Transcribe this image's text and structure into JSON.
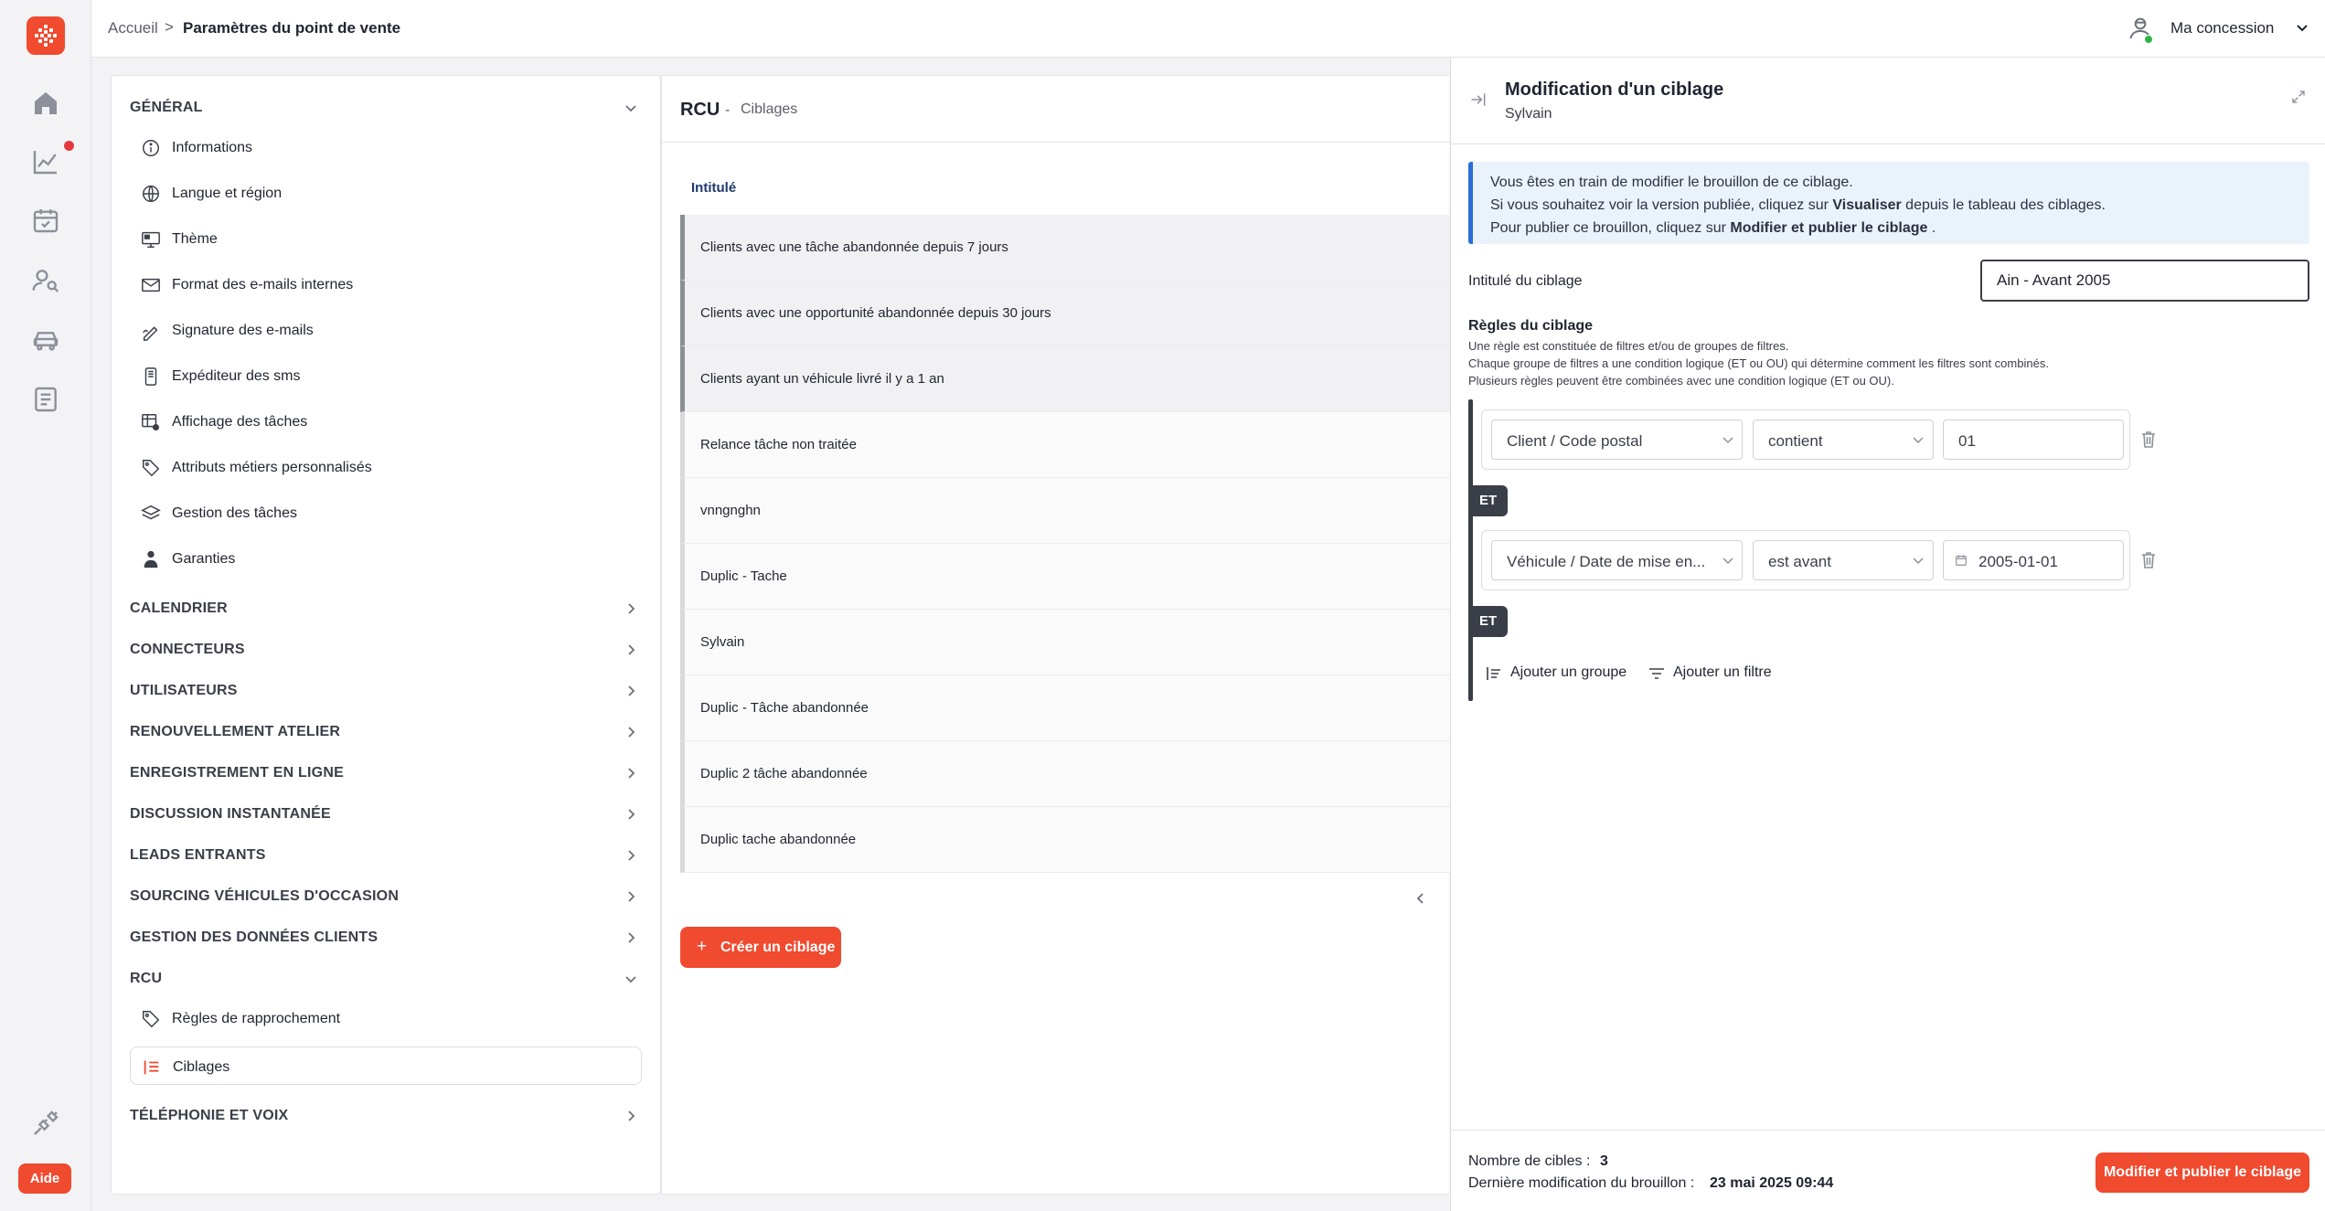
{
  "colors": {
    "brand": "#f04a2f",
    "info_bg": "#eaf2fc",
    "info_border": "#2a6ed8",
    "online": "#2fb344",
    "notification": "#e5393f"
  },
  "rail": {
    "icons": [
      "home-icon",
      "chart-line-icon",
      "calendar-check-icon",
      "user-search-icon",
      "car-icon",
      "document-list-icon",
      "plug-icon"
    ],
    "help_label": "Aide"
  },
  "header": {
    "breadcrumb_home": "Accueil",
    "breadcrumb_separator": ">",
    "breadcrumb_current": "Paramètres du point de vente",
    "user_name": "Ma concession"
  },
  "settings_nav": {
    "general": {
      "title": "GÉNÉRAL",
      "items": [
        {
          "label": "Informations",
          "icon": "info-circle-icon"
        },
        {
          "label": "Langue et région",
          "icon": "globe-icon"
        },
        {
          "label": "Thème",
          "icon": "monitor-palette-icon"
        },
        {
          "label": "Format des e-mails internes",
          "icon": "mail-settings-icon"
        },
        {
          "label": "Signature des e-mails",
          "icon": "signature-icon"
        },
        {
          "label": "Expéditeur des sms",
          "icon": "phone-icon"
        },
        {
          "label": "Affichage des tâches",
          "icon": "table-settings-icon"
        },
        {
          "label": "Attributs métiers personnalisés",
          "icon": "tags-icon"
        },
        {
          "label": "Gestion des tâches",
          "icon": "layers-icon"
        },
        {
          "label": "Garanties",
          "icon": "person-badge-icon"
        }
      ]
    },
    "sections": [
      "CALENDRIER",
      "CONNECTEURS",
      "UTILISATEURS",
      "RENOUVELLEMENT ATELIER",
      "ENREGISTREMENT EN LIGNE",
      "DISCUSSION INSTANTANÉE",
      "LEADS ENTRANTS",
      "SOURCING VÉHICULES D'OCCASION",
      "GESTION DES DONNÉES CLIENTS"
    ],
    "rcu": {
      "title": "RCU",
      "items": [
        {
          "label": "Règles de rapprochement",
          "icon": "tag-icon"
        },
        {
          "label": "Ciblages",
          "icon": "list-icon"
        }
      ]
    },
    "last_section": "TÉLÉPHONIE ET VOIX"
  },
  "list": {
    "title": "RCU",
    "separator": "-",
    "subtitle": "Ciblages",
    "column_header": "Intitulé",
    "rows": [
      "Clients avec une tâche abandonnée depuis 7 jours",
      "Clients avec une opportunité abandonnée depuis 30 jours",
      "Clients ayant un véhicule livré il y a 1 an",
      "Relance tâche non traitée",
      "vnngnghn",
      "Duplic - Tache",
      "Sylvain",
      "Duplic - Tâche abandonnée",
      "Duplic 2 tâche abandonnée",
      "Duplic tache abandonnée"
    ],
    "create_plus": "+",
    "create_button": "Créer un ciblage"
  },
  "edit": {
    "title": "Modification d'un ciblage",
    "subtitle": "Sylvain",
    "info": {
      "line1": "Vous êtes en train de modifier le brouillon de ce ciblage.",
      "line2_pre": "Si vous souhaitez voir la version publiée, cliquez sur ",
      "line2_bold": "Visualiser",
      "line2_post": " depuis le tableau des ciblages.",
      "line3_pre": "Pour publier ce brouillon, cliquez sur ",
      "line3_bold": "Modifier et publier le ciblage",
      "line3_post": " ."
    },
    "title_label": "Intitulé du ciblage",
    "title_value": "Ain - Avant 2005",
    "rules_heading": "Règles du ciblage",
    "rules_desc": [
      "Une règle est constituée de filtres et/ou de groupes de filtres.",
      "Chaque groupe de filtres a une condition logique (ET ou OU) qui détermine comment les filtres sont combinés.",
      "Plusieurs règles peuvent être combinées avec une condition logique (ET ou OU)."
    ],
    "filters": [
      {
        "field": "Client / Code postal",
        "operator": "contient",
        "value": "01"
      },
      {
        "field": "Véhicule / Date de mise en...",
        "operator": "est avant",
        "value": "2005-01-01"
      }
    ],
    "logic_labels": [
      "ET",
      "ET"
    ],
    "add_group": "Ajouter un groupe",
    "add_filter": "Ajouter un filtre",
    "targets_label": "Nombre de cibles :",
    "targets_value": "3",
    "last_modified_label": "Dernière modification du brouillon :",
    "last_modified_value": "23 mai 2025 09:44",
    "publish_button": "Modifier et publier le ciblage"
  }
}
